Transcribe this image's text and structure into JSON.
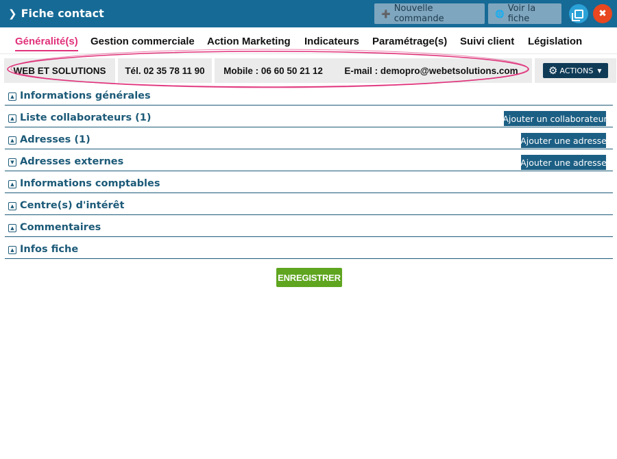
{
  "window": {
    "title": "Fiche contact",
    "buttons": {
      "new_order": "Nouvelle commande",
      "view_card": "Voir la fiche",
      "close_symbol": "✖"
    }
  },
  "tabs": [
    {
      "label": "Généralité(s)",
      "active": true
    },
    {
      "label": "Gestion commerciale",
      "active": false
    },
    {
      "label": "Action Marketing",
      "active": false
    },
    {
      "label": "Indicateurs",
      "active": false
    },
    {
      "label": "Paramétrage(s)",
      "active": false
    },
    {
      "label": "Suivi client",
      "active": false
    },
    {
      "label": "Législation",
      "active": false
    }
  ],
  "contact_bar": {
    "company": "WEB ET SOLUTIONS",
    "phone": "Tél. 02 35 78 11 90",
    "mobile": "Mobile : 06 60 50 21 12",
    "email": "E-mail : demopro@webetsolutions.com",
    "actions_label": "ACTIONS"
  },
  "sections": [
    {
      "label": "Informations générales",
      "state": "collapsed",
      "button": ""
    },
    {
      "label": "Liste collaborateurs (1)",
      "state": "collapsed",
      "button": "Ajouter un collaborateur"
    },
    {
      "label": "Adresses (1)",
      "state": "collapsed",
      "button": "Ajouter une adresse"
    },
    {
      "label": "Adresses externes",
      "state": "expanded",
      "button": "Ajouter une adresse"
    },
    {
      "label": "Informations comptables",
      "state": "collapsed",
      "button": ""
    },
    {
      "label": "Centre(s) d'intérêt",
      "state": "collapsed",
      "button": ""
    },
    {
      "label": "Commentaires",
      "state": "collapsed",
      "button": ""
    },
    {
      "label": "Infos fiche",
      "state": "collapsed",
      "button": ""
    }
  ],
  "save_label": "ENREGISTRER",
  "colors": {
    "title_bar": "#166a96",
    "active_tab": "#e0317a",
    "section_text": "#1c5a78",
    "save_button": "#5fa520",
    "highlight_ellipse": "#e0317a"
  }
}
